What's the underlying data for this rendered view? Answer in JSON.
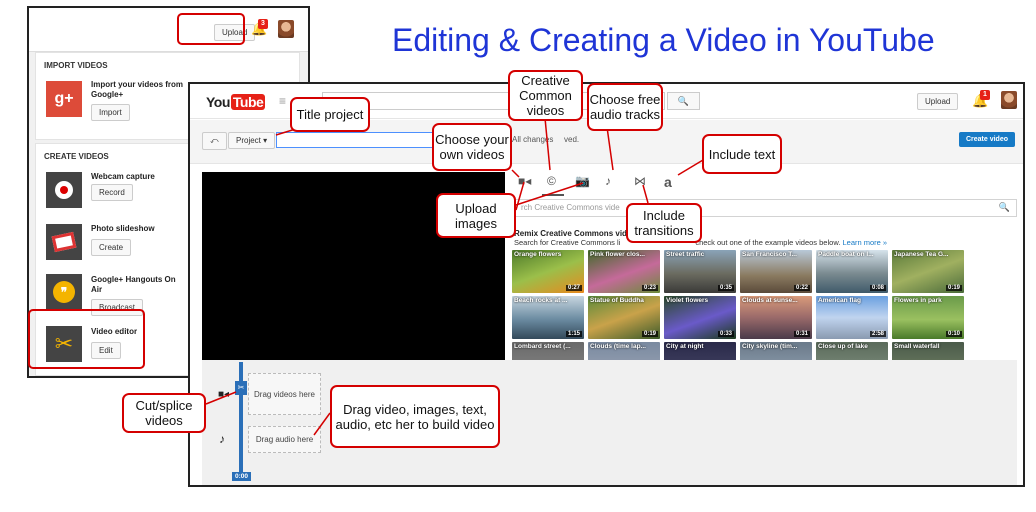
{
  "slide_title": "Editing & Creating a Video in YouTube",
  "left_panel": {
    "upload_label": "Upload",
    "notification_count": "3",
    "import_section": "IMPORT VIDEOS",
    "import_item": {
      "title": "Import your videos from Google+",
      "button": "Import"
    },
    "create_section": "CREATE VIDEOS",
    "create_items": [
      {
        "title": "Webcam capture",
        "button": "Record"
      },
      {
        "title": "Photo slideshow",
        "button": "Create"
      },
      {
        "title": "Google+ Hangouts On Air",
        "button": "Broadcast"
      },
      {
        "title": "Video editor",
        "button": "Edit"
      }
    ]
  },
  "editor": {
    "logo_you": "You",
    "logo_tube": "Tube",
    "upload_label": "Upload",
    "notification_count": "1",
    "project_label": "Project",
    "saved_status_start": "All changes",
    "saved_status_end": "ved.",
    "create_video_label": "Create video",
    "cc_search_placeholder": "rch Creative Commons vide",
    "cc_title": "Remix Creative Commons vide",
    "cc_desc_start": "Search for Creative Commons li",
    "cc_desc_end": "check out one of the example videos below.",
    "learn_more": "Learn more »",
    "thumbnails": [
      {
        "title": "Orange flowers",
        "duration": "0:27"
      },
      {
        "title": "Pink flower clos...",
        "duration": "0:23"
      },
      {
        "title": "Street traffic",
        "duration": "0:35"
      },
      {
        "title": "San Francisco T...",
        "duration": "0:22"
      },
      {
        "title": "Paddle boat on l...",
        "duration": "0:08"
      },
      {
        "title": "Japanese Tea G...",
        "duration": "0:19"
      },
      {
        "title": "Beach rocks at ...",
        "duration": "1:15"
      },
      {
        "title": "Statue of Buddha",
        "duration": "0:19"
      },
      {
        "title": "Violet flowers",
        "duration": "0:33"
      },
      {
        "title": "Clouds at sunse...",
        "duration": "0:31"
      },
      {
        "title": "American flag",
        "duration": "2:58"
      },
      {
        "title": "Flowers in park",
        "duration": "0:10"
      },
      {
        "title": "Lombard street (...",
        "duration": ""
      },
      {
        "title": "Clouds (time lap...",
        "duration": ""
      },
      {
        "title": "City at night",
        "duration": ""
      },
      {
        "title": "City skyline (tim...",
        "duration": ""
      },
      {
        "title": "Close up of lake",
        "duration": ""
      },
      {
        "title": "Small waterfall",
        "duration": ""
      }
    ],
    "drag_videos": "Drag videos here",
    "drag_audio": "Drag audio here",
    "timecode": "0:00"
  },
  "callouts": {
    "title_project": "Title project",
    "creative_common": "Creative Common videos",
    "free_audio": "Choose free audio tracks",
    "own_videos": "Choose your own videos",
    "include_text": "Include text",
    "upload_images": "Upload images",
    "include_transitions": "Include transitions",
    "cut_splice": "Cut/splice videos",
    "drag_build": "Drag video, images, text, audio, etc her to build video"
  },
  "colors": {
    "callout_border": "#d40000",
    "title_blue": "#1f35d6",
    "youtube_red": "#e62117",
    "create_blue": "#167ac6"
  }
}
